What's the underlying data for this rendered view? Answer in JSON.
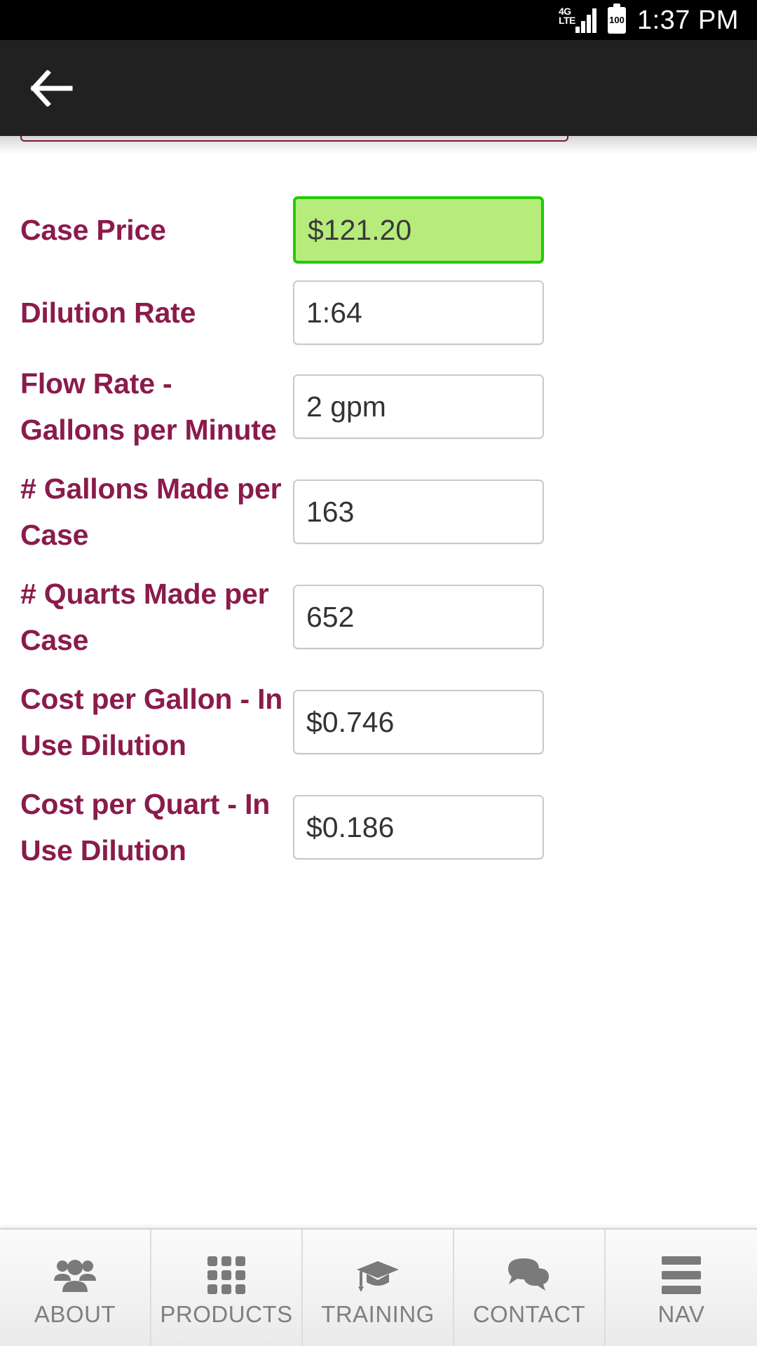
{
  "status_bar": {
    "network_label": "4G\nLTE",
    "network_line1": "4G",
    "network_line2": "LTE",
    "battery_level": "100",
    "time": "1:37 PM"
  },
  "header": {
    "back_icon": "arrow-left-icon"
  },
  "theme": {
    "label_color": "#8a1b4b",
    "highlight_fill": "#b6ec7c",
    "highlight_border": "#1fcc00",
    "header_background": "#212121",
    "field_border": "#c9c9c9"
  },
  "form": {
    "fields": [
      {
        "label": "Case Price",
        "value": "$121.20",
        "highlighted": true
      },
      {
        "label": "Dilution Rate",
        "value": "1:64",
        "highlighted": false
      },
      {
        "label": "Flow Rate - Gallons per Minute",
        "value": "2 gpm",
        "highlighted": false
      },
      {
        "label": "# Gallons Made per Case",
        "value": "163",
        "highlighted": false
      },
      {
        "label": "# Quarts Made per Case",
        "value": "652",
        "highlighted": false
      },
      {
        "label": "Cost per Gallon - In Use Dilution",
        "value": "$0.746",
        "highlighted": false
      },
      {
        "label": "Cost per Quart - In Use Dilution",
        "value": "$0.186",
        "highlighted": false
      }
    ]
  },
  "tabbar": {
    "tabs": [
      {
        "label": "ABOUT",
        "icon": "people-icon"
      },
      {
        "label": "PRODUCTS",
        "icon": "grid-icon"
      },
      {
        "label": "TRAINING",
        "icon": "graduation-cap-icon"
      },
      {
        "label": "CONTACT",
        "icon": "chat-bubbles-icon"
      },
      {
        "label": "NAV",
        "icon": "hamburger-menu-icon"
      }
    ]
  }
}
